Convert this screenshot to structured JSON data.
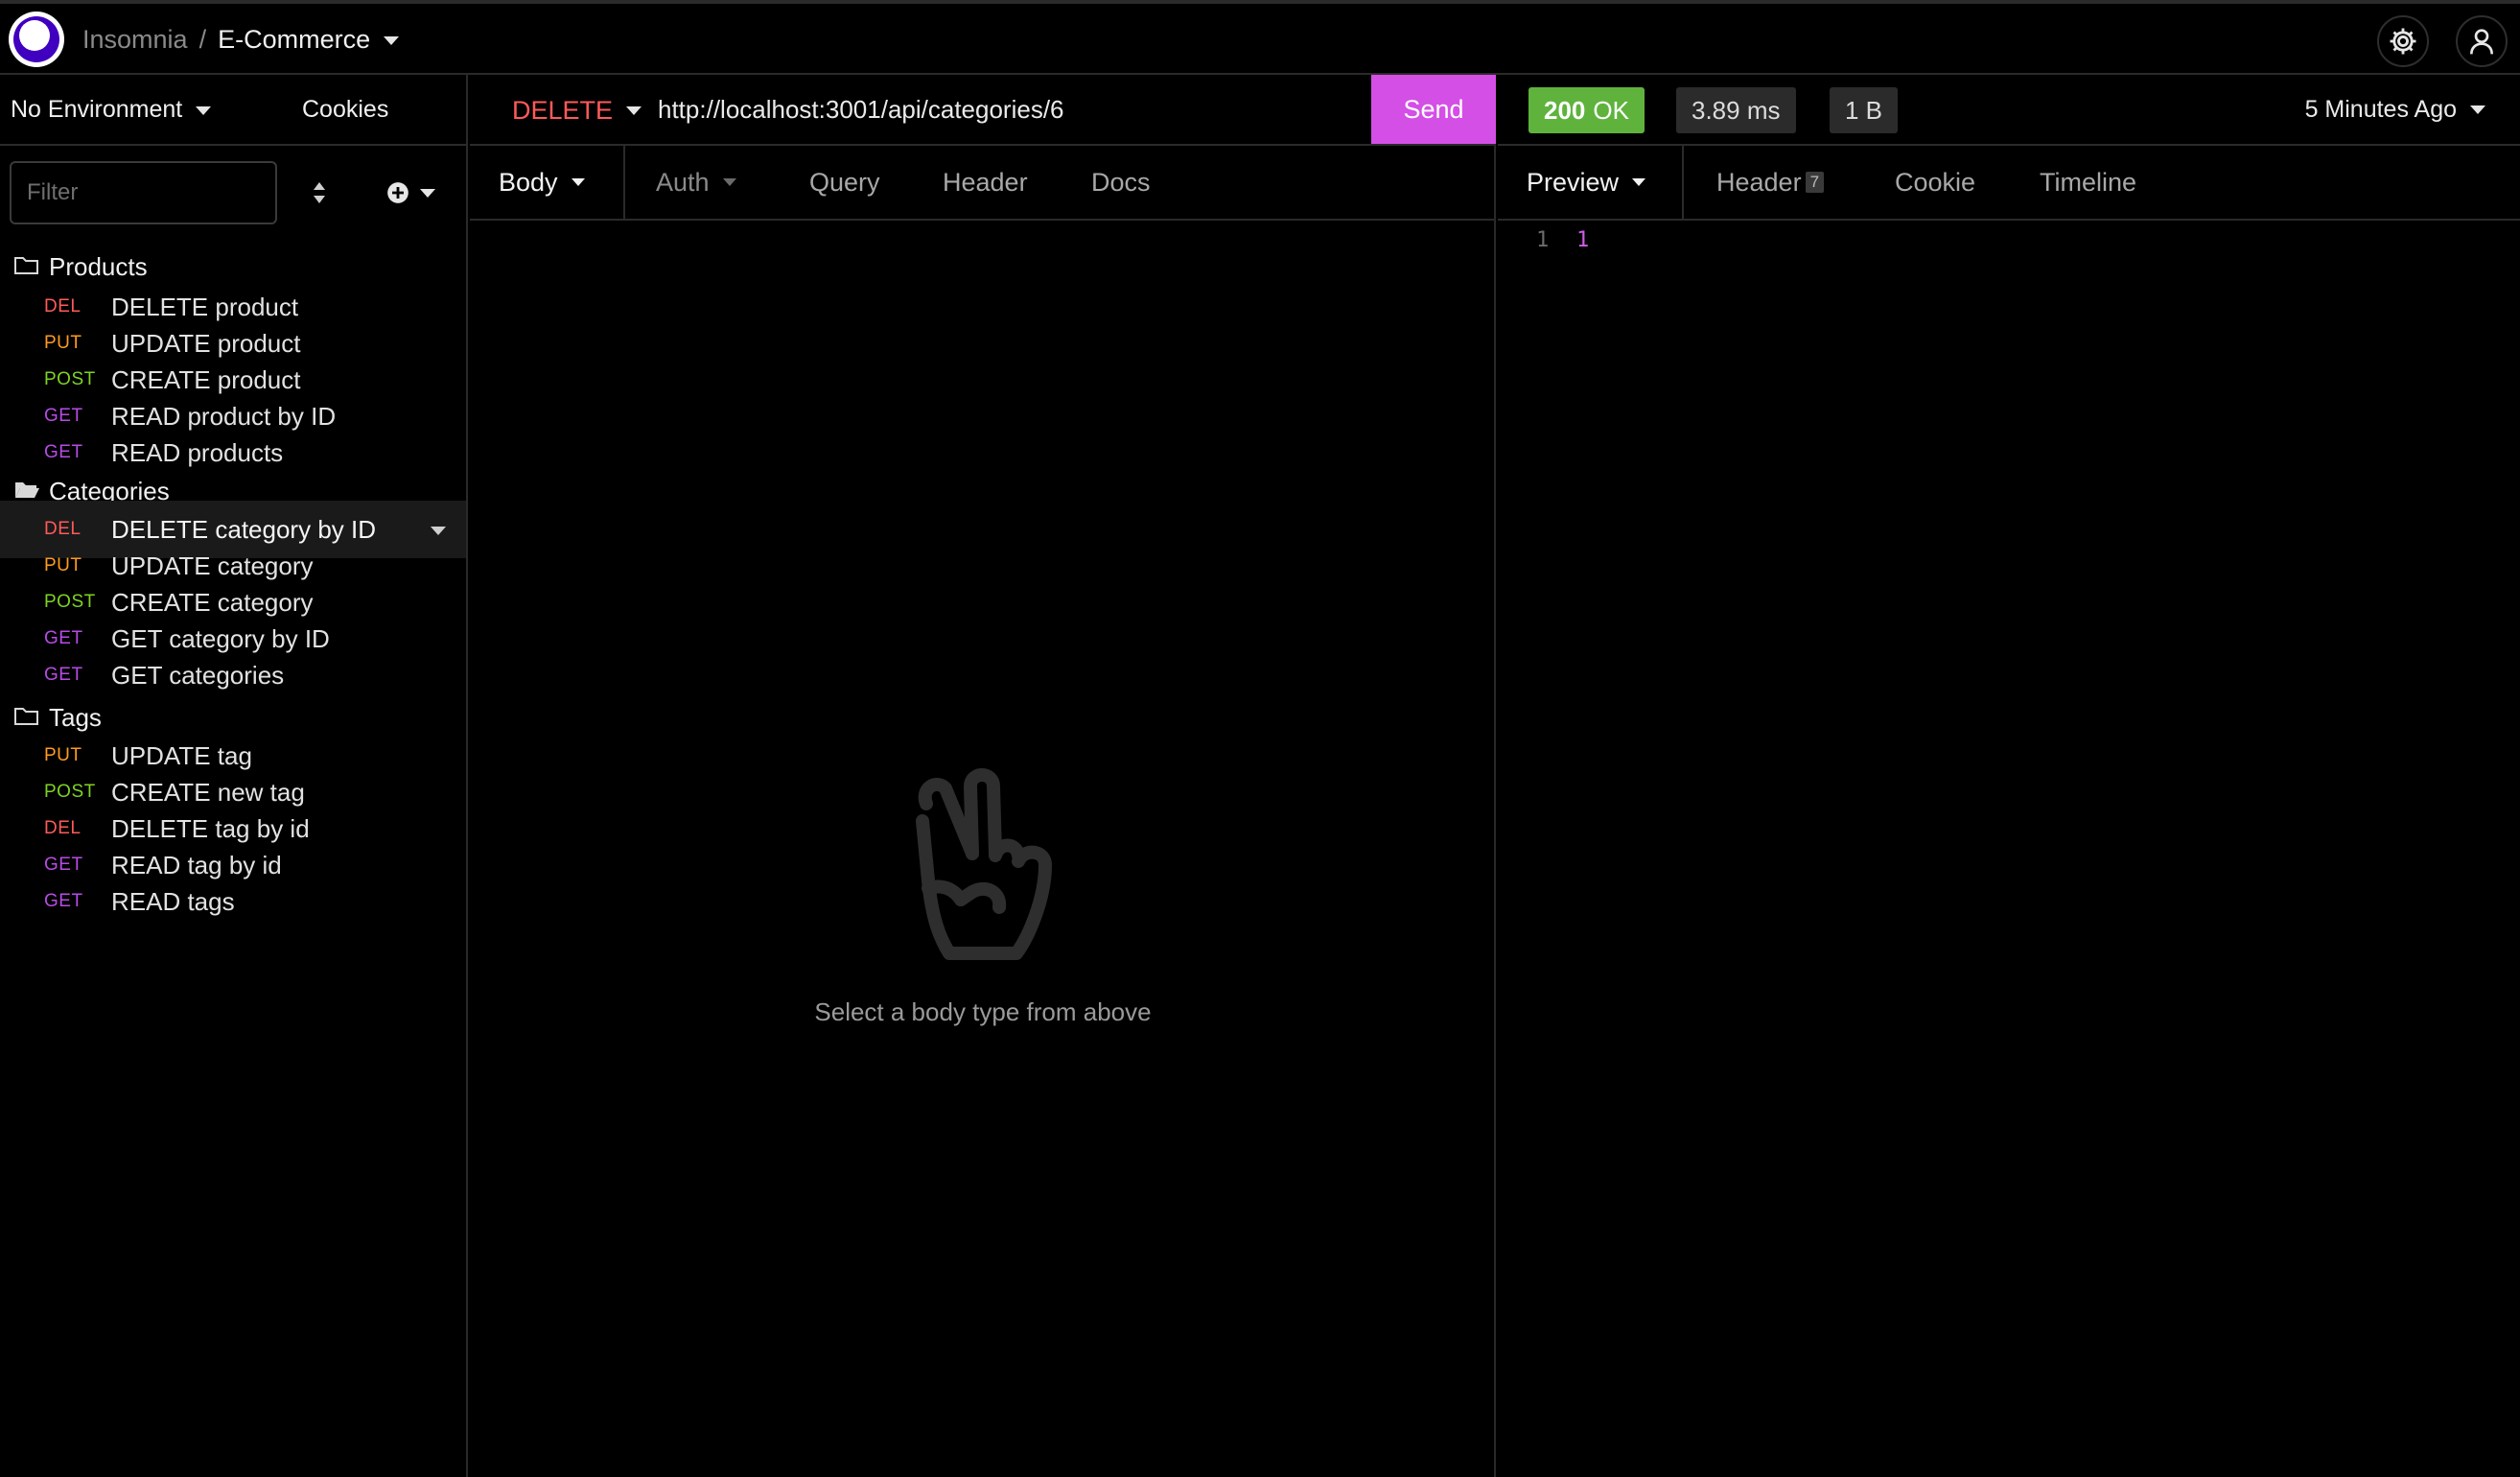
{
  "header": {
    "app_name": "Insomnia",
    "separator": "/",
    "workspace": "E-Commerce",
    "settings_icon": "gear-icon",
    "account_icon": "user-icon"
  },
  "sidebar": {
    "environment": "No Environment",
    "cookies_label": "Cookies",
    "filter_placeholder": "Filter",
    "folders": [
      {
        "name": "Products",
        "requests": [
          {
            "method": "DEL",
            "name": "DELETE product"
          },
          {
            "method": "PUT",
            "name": "UPDATE product"
          },
          {
            "method": "POST",
            "name": "CREATE product"
          },
          {
            "method": "GET",
            "name": "READ product by ID"
          },
          {
            "method": "GET",
            "name": "READ products"
          }
        ]
      },
      {
        "name": "Categories",
        "requests": [
          {
            "method": "DEL",
            "name": "DELETE category by ID",
            "active": true
          },
          {
            "method": "PUT",
            "name": "UPDATE category"
          },
          {
            "method": "POST",
            "name": "CREATE category"
          },
          {
            "method": "GET",
            "name": "GET category by ID"
          },
          {
            "method": "GET",
            "name": "GET categories"
          }
        ]
      },
      {
        "name": "Tags",
        "requests": [
          {
            "method": "PUT",
            "name": "UPDATE tag"
          },
          {
            "method": "POST",
            "name": "CREATE new tag"
          },
          {
            "method": "DEL",
            "name": "DELETE tag by id"
          },
          {
            "method": "GET",
            "name": "READ tag by id"
          },
          {
            "method": "GET",
            "name": "READ tags"
          }
        ]
      }
    ]
  },
  "request": {
    "method": "DELETE",
    "url": "http://localhost:3001/api/categories/6",
    "send_label": "Send",
    "tabs": [
      "Body",
      "Auth",
      "Query",
      "Header",
      "Docs"
    ],
    "empty_message": "Select a body type from above"
  },
  "response": {
    "status_code": "200",
    "status_text": "OK",
    "time": "3.89 ms",
    "size": "1 B",
    "age": "5 Minutes Ago",
    "tabs": [
      "Preview",
      "Header",
      "Cookie",
      "Timeline"
    ],
    "header_count": "7",
    "lines": [
      {
        "number": "1",
        "value": "1"
      }
    ]
  },
  "colors": {
    "accent": "#d44fe6",
    "status_ok": "#5fb33d",
    "method_del": "#ff5a5a",
    "method_put": "#ff9a1f",
    "method_post": "#7ed321",
    "method_get": "#b84be6"
  }
}
